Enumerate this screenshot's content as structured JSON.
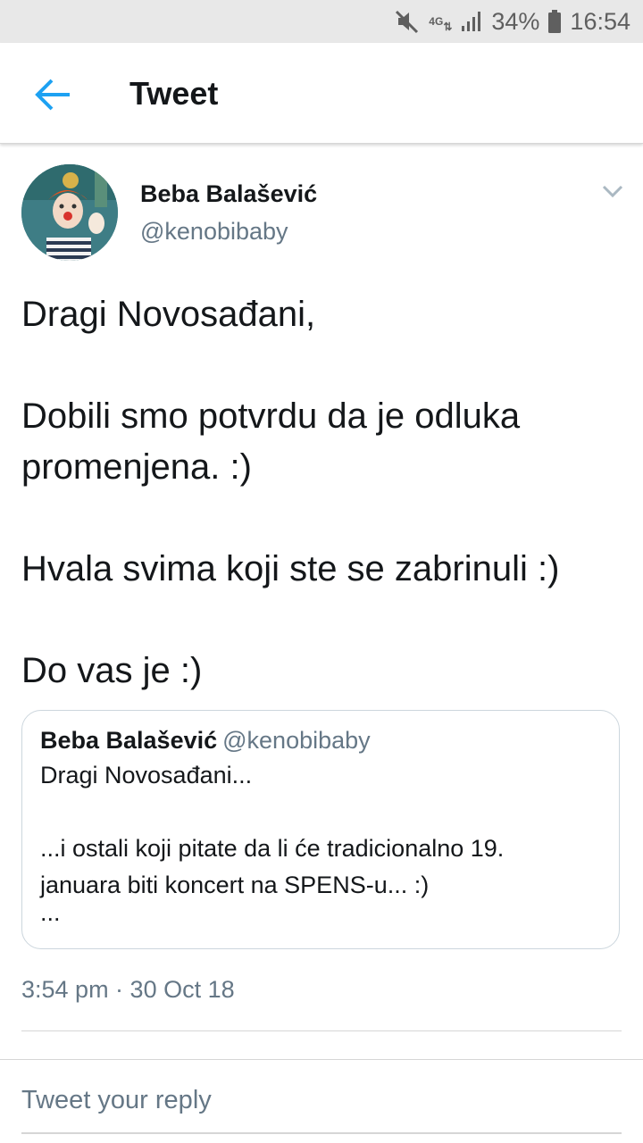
{
  "status_bar": {
    "network": "4G",
    "battery": "34%",
    "time": "16:54",
    "icons": [
      "mute-icon",
      "network-4g-icon",
      "signal-icon",
      "battery-icon"
    ]
  },
  "header": {
    "title": "Tweet",
    "back_icon": "back-arrow-icon"
  },
  "tweet": {
    "display_name": "Beba Balašević",
    "handle": "@kenobibaby",
    "paragraphs": [
      "Dragi Novosađani,",
      "Dobili smo potvrdu da je odluka promenjena. :)",
      "Hvala svima koji ste se zabrinuli :)",
      "Do vas je :)"
    ],
    "timestamp": "3:54 pm · 30 Oct 18"
  },
  "quoted_tweet": {
    "display_name": "Beba Balašević",
    "handle": "@kenobibaby",
    "line1": "Dragi Novosađani...",
    "line2": "...i ostali koji pitate da li će tradicionalno 19.",
    "line3": "januara biti koncert na SPENS-u... :)",
    "ellipsis": "..."
  },
  "reply": {
    "placeholder": "Tweet your reply"
  },
  "colors": {
    "accent": "#1da1f2",
    "secondary_text": "#657786",
    "status_bar_bg": "#e8e8e8"
  }
}
